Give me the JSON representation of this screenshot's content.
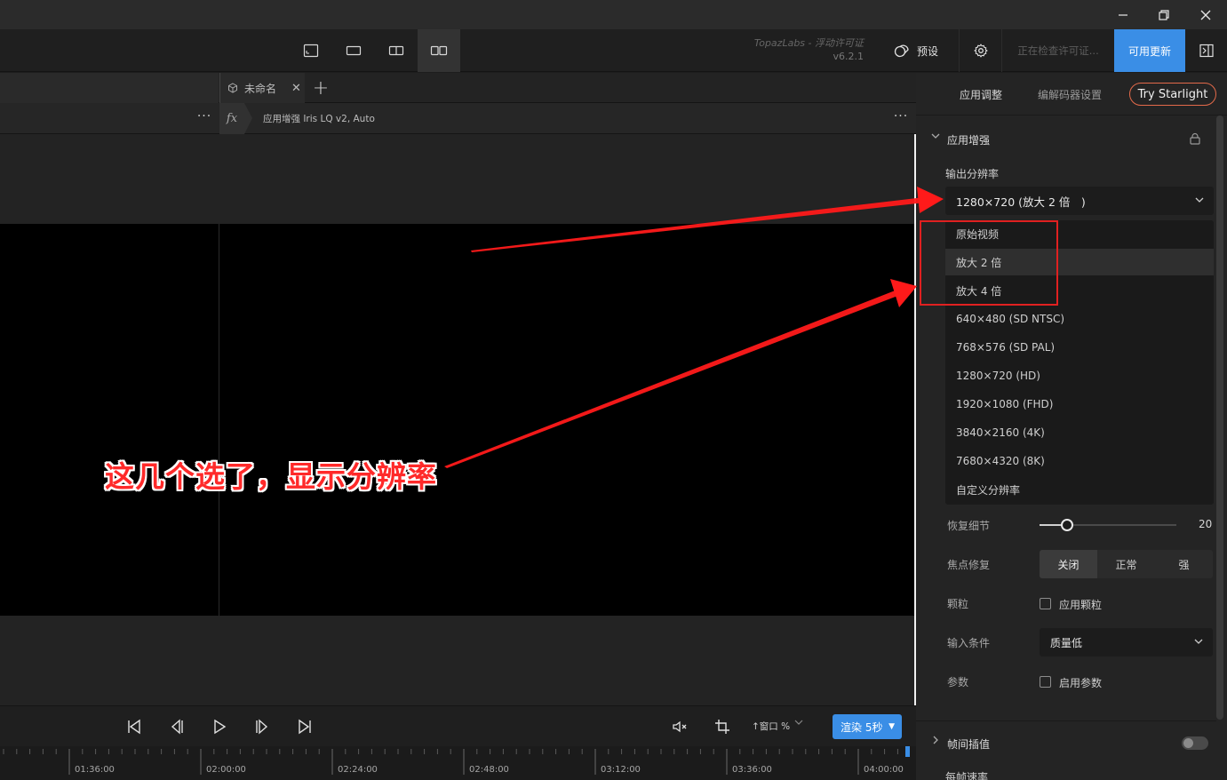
{
  "titlebar": {
    "icons": [
      "minimize-icon",
      "restore-icon",
      "close-icon"
    ]
  },
  "toolbar": {
    "brand": "TopazLabs - 浮动许可证",
    "version": "v6.2.1",
    "preset_label": "预设",
    "license_status": "正在检查许可证...",
    "update_label": "可用更新"
  },
  "tabs": {
    "project_name": "未命名"
  },
  "filter": {
    "label": "应用增强 Iris LQ v2, Auto",
    "fx": "fx",
    "more": "···"
  },
  "annotation": {
    "text": "这几个选了，显示分辨率"
  },
  "controls": {
    "zoom_label": "↑窗口 %",
    "render_label": "渲染 5秒"
  },
  "timeline": {
    "labels": [
      "01:36:00",
      "02:00:00",
      "02:24:00",
      "02:48:00",
      "03:12:00",
      "03:36:00",
      "04:00:00"
    ]
  },
  "panel": {
    "tabs": [
      "应用调整",
      "编解码器设置"
    ],
    "starlight": "Try Starlight",
    "section_enhance": "应用增强",
    "output_res_label": "输出分辨率",
    "output_res_value": "1280×720 (放大 2 倍　)",
    "dropdown_options": [
      "原始视频",
      "放大 2 倍",
      "放大 4 倍",
      "640×480 (SD NTSC)",
      "768×576 (SD PAL)",
      "1280×720 (HD)",
      "1920×1080 (FHD)",
      "3840×2160 (4K)",
      "7680×4320 (8K)",
      "自定义分辨率"
    ],
    "recover_detail_label": "恢复细节",
    "recover_detail_value": "20",
    "recover_detail_level": 0.2,
    "focus_label": "焦点修复",
    "focus_options": [
      "关闭",
      "正常",
      "强"
    ],
    "focus_selected": "关闭",
    "grain_label": "颗粒",
    "grain_checkbox": "应用颗粒",
    "input_cond_label": "输入条件",
    "input_cond_value": "质量低",
    "params_label": "参数",
    "params_checkbox": "启用参数",
    "section_interp": "帧间插值",
    "fps_label": "每帧速率"
  },
  "colors": {
    "accent": "#3a8ee6",
    "annotation": "#ff2a2a",
    "starlight_border": "#e36a4a"
  }
}
